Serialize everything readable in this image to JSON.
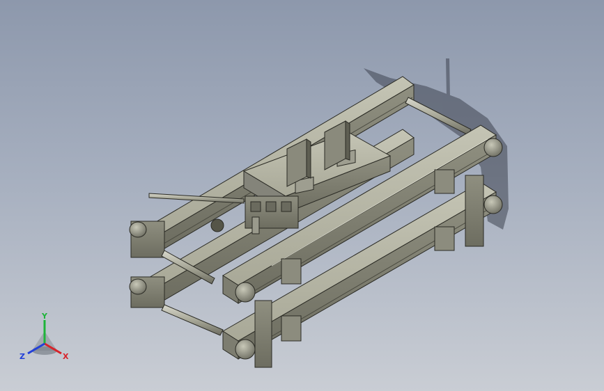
{
  "view": {
    "background_top": "#8d98ac",
    "background_bottom": "#c9cdd4",
    "part_color": "#a5a594",
    "edge_color": "#2a2a24"
  },
  "triad": {
    "x_label": "X",
    "y_label": "Y",
    "z_label": "Z",
    "x_color": "#d8232a",
    "y_color": "#1fb43a",
    "z_color": "#2340d8"
  }
}
